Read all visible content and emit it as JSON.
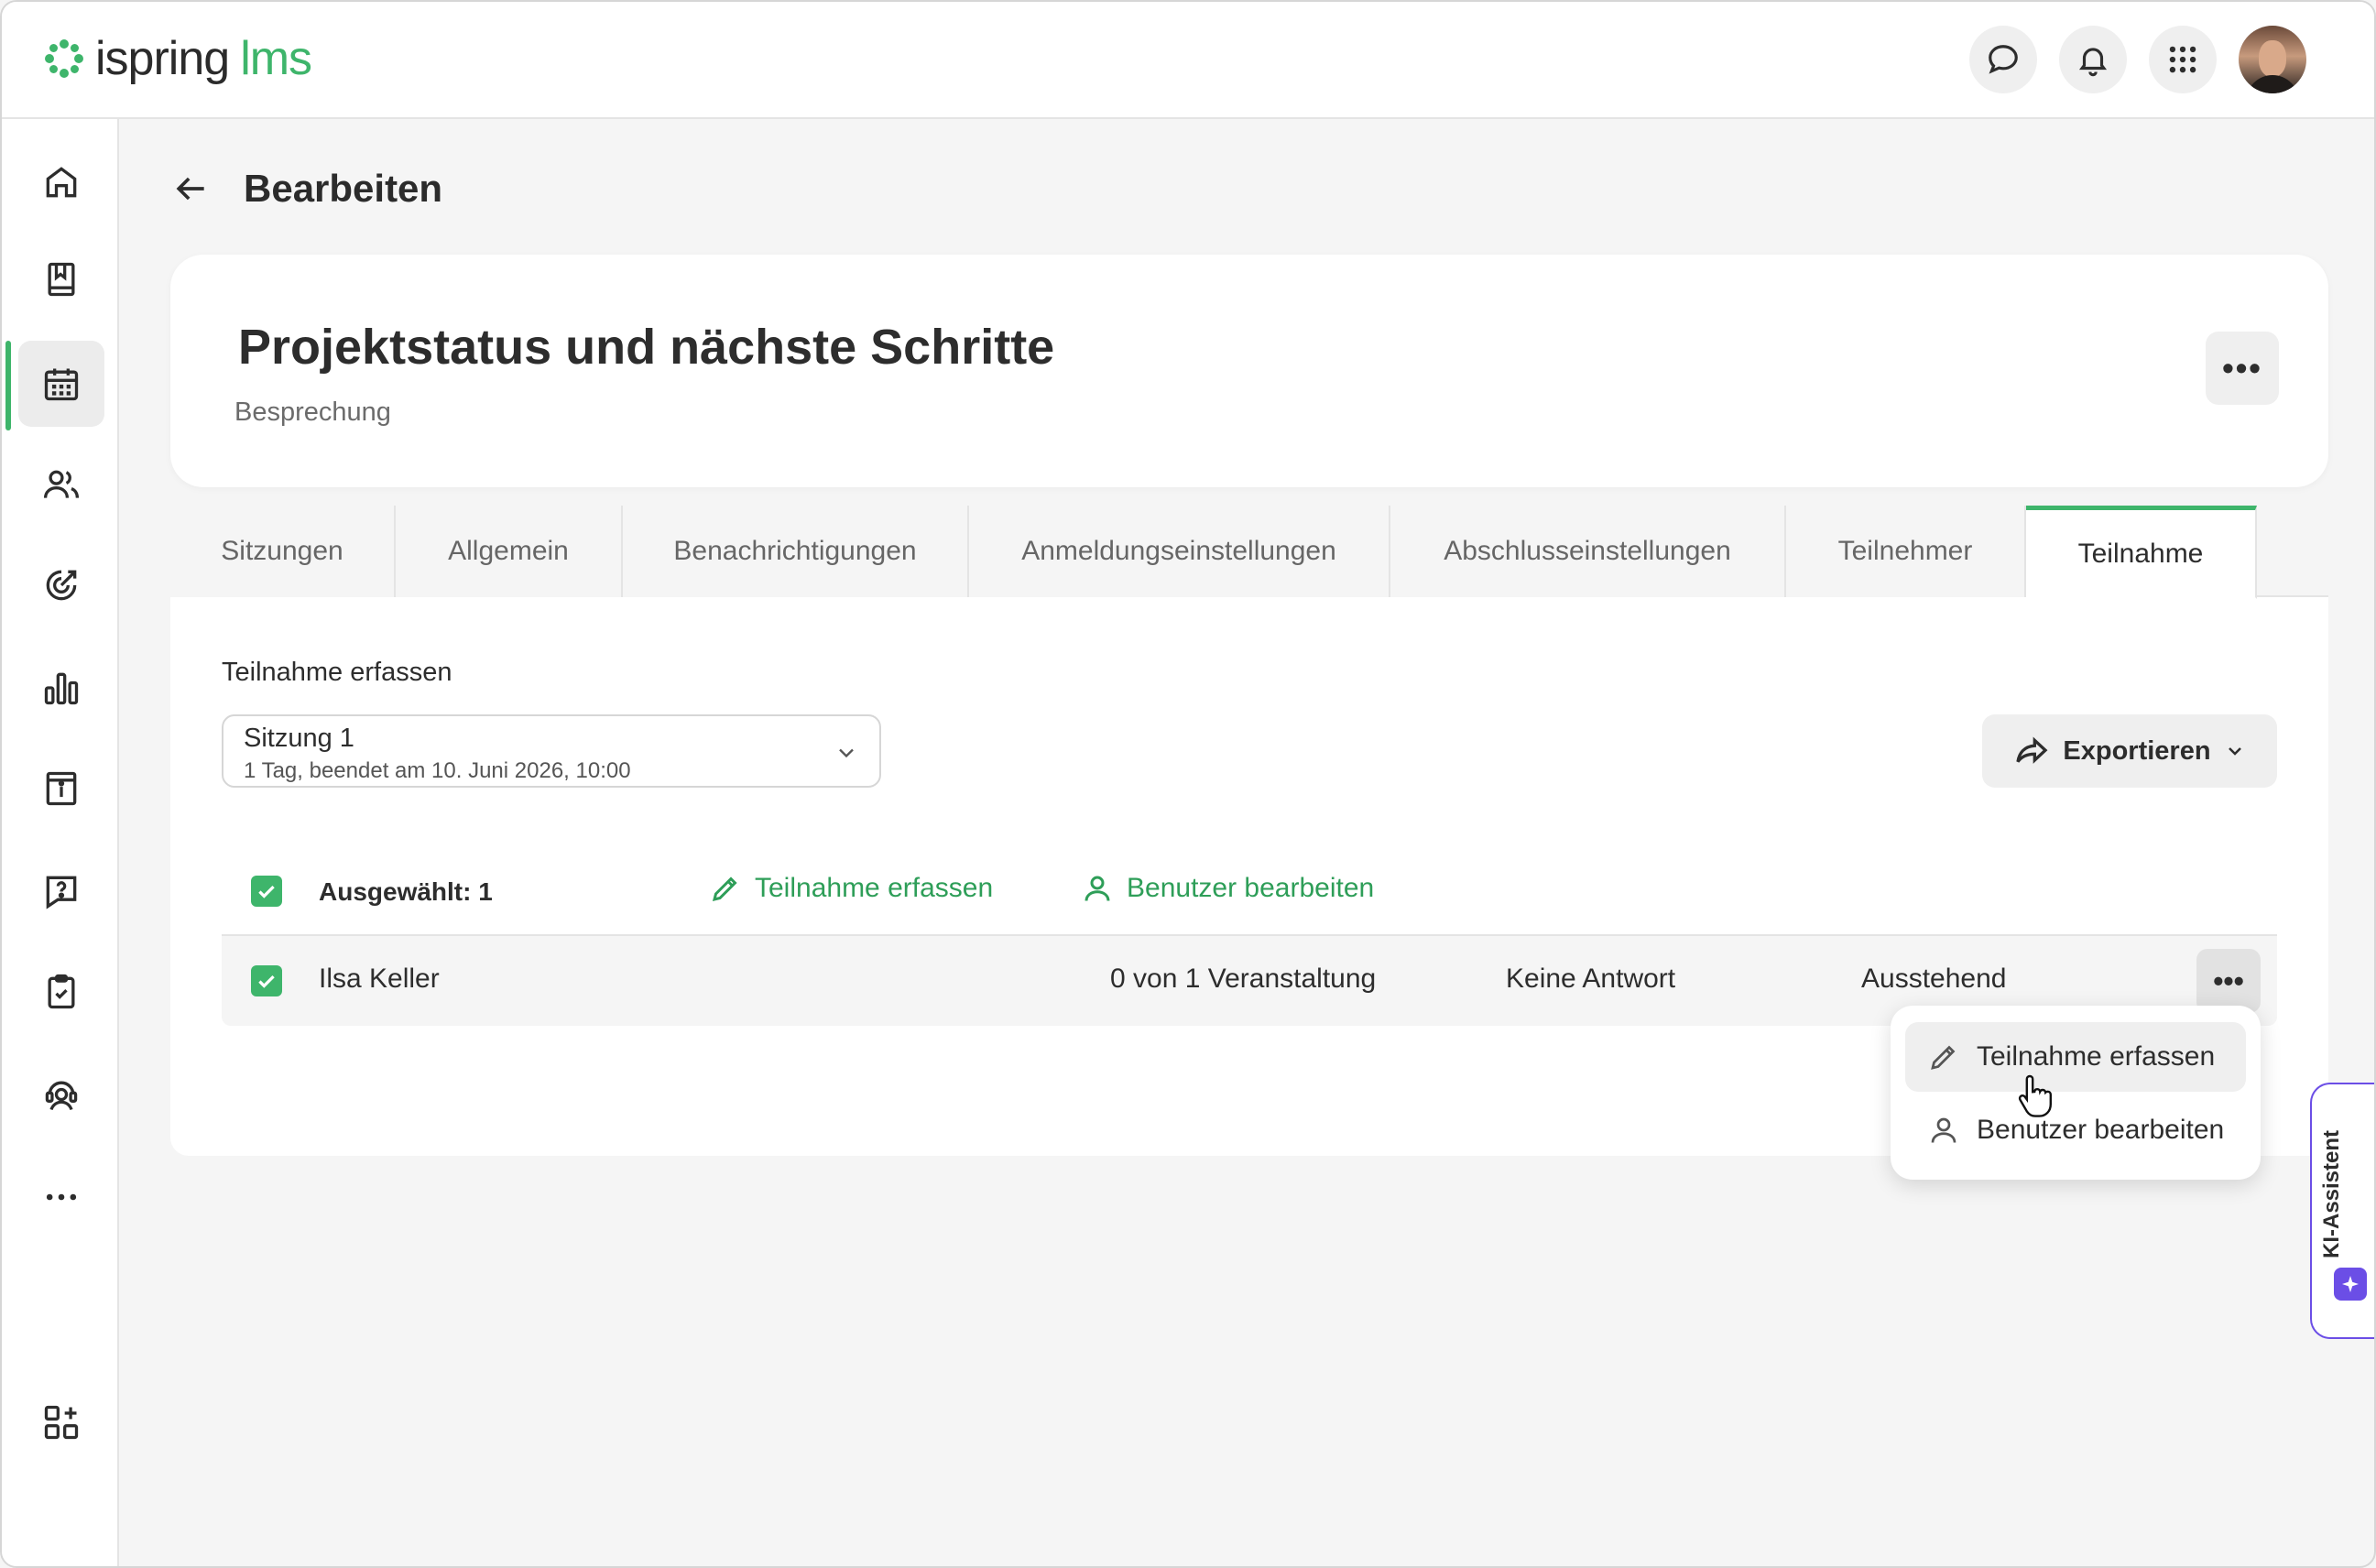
{
  "header": {
    "brand_name": "ispring",
    "brand_suffix": "lms",
    "accent_color": "#3eb56b",
    "icons": [
      "chat-icon",
      "bell-icon",
      "apps-grid-icon"
    ]
  },
  "sidebar": {
    "items": [
      {
        "icon": "home-icon"
      },
      {
        "icon": "book-icon"
      },
      {
        "icon": "calendar-icon",
        "active": true
      },
      {
        "icon": "users-icon"
      },
      {
        "icon": "target-icon"
      },
      {
        "icon": "bar-chart-icon"
      },
      {
        "icon": "info-panel-icon"
      },
      {
        "icon": "question-bubble-icon"
      },
      {
        "icon": "clipboard-check-icon"
      },
      {
        "icon": "support-agent-icon"
      },
      {
        "icon": "more-horizontal-icon"
      },
      {
        "icon": "add-widget-icon"
      }
    ]
  },
  "page": {
    "title": "Bearbeiten"
  },
  "event": {
    "name": "Projektstatus und nächste Schritte",
    "type": "Besprechung",
    "more_label": "•••"
  },
  "tabs": [
    {
      "label": "Sitzungen"
    },
    {
      "label": "Allgemein"
    },
    {
      "label": "Benachrichtigungen"
    },
    {
      "label": "Anmeldungseinstellungen"
    },
    {
      "label": "Abschlusseinstellungen"
    },
    {
      "label": "Teilnehmer"
    },
    {
      "label": "Teilnahme",
      "active": true
    }
  ],
  "attendance": {
    "section_label": "Teilnahme erfassen",
    "session_select": {
      "value": "Sitzung 1",
      "detail": "1 Tag, beendet am 10. Juni 2026, 10:00"
    },
    "export_label": "Exportieren",
    "toolbar": {
      "selected_count": "Ausgewählt: 1",
      "record_label": "Teilnahme erfassen",
      "edit_user_label": "Benutzer bearbeiten"
    },
    "rows": [
      {
        "name": "Ilsa Keller",
        "events": "0 von 1 Veranstaltung",
        "response": "Keine Antwort",
        "status": "Ausstehend",
        "checked": true
      }
    ],
    "row_more_label": "•••"
  },
  "context_menu": {
    "items": [
      {
        "label": "Teilnahme erfassen",
        "icon": "pencil-icon"
      },
      {
        "label": "Benutzer bearbeiten",
        "icon": "user-icon"
      }
    ]
  },
  "assistant": {
    "label": "KI-Assistent",
    "color": "#6b4ee6"
  }
}
